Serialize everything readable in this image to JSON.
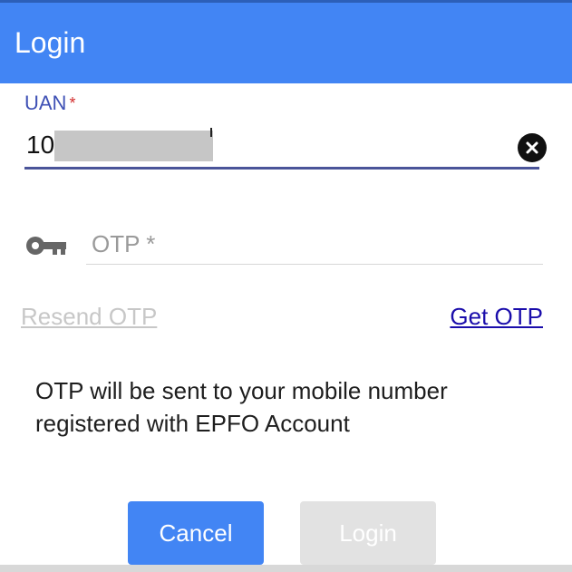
{
  "header": {
    "title": "Login"
  },
  "uan_field": {
    "label": "UAN",
    "required_mark": "*",
    "value_visible": "10",
    "clear_icon": "close-circle-icon"
  },
  "otp_field": {
    "icon": "key-icon",
    "placeholder": "OTP *"
  },
  "links": {
    "resend": "Resend OTP",
    "get_otp": "Get OTP"
  },
  "info": {
    "message": "OTP will be sent to your mobile number registered with EPFO Account"
  },
  "buttons": {
    "cancel": "Cancel",
    "login": "Login"
  },
  "colors": {
    "header": "#4285f4",
    "primary_button": "#4285f4",
    "disabled_button": "#e2e2e2",
    "link": "#1a0dab",
    "required": "#d32f2f",
    "field_accent": "#3f51b5"
  }
}
